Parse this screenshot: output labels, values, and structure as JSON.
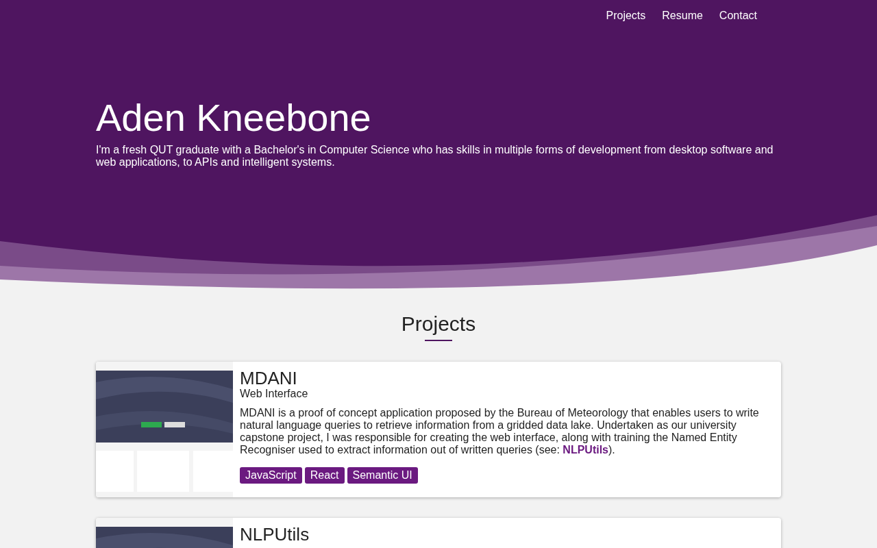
{
  "nav": [
    {
      "label": "Projects"
    },
    {
      "label": "Resume"
    },
    {
      "label": "Contact"
    }
  ],
  "hero": {
    "title": "Aden Kneebone",
    "intro": "I'm a fresh QUT graduate with a Bachelor's in Computer Science who has skills in multiple forms of development from desktop software and web applications, to APIs and intelligent systems."
  },
  "projects_heading": "Projects",
  "projects": [
    {
      "title": "MDANI",
      "subtitle": "Web Interface",
      "description": {
        "before": "MDANI is a proof of concept application proposed by the Bureau of Meteorology that enables users to write natural language queries to retrieve information from a gridded data lake. Undertaken as our university capstone project, I was responsible for creating the web interface, along with training the Named Entity Recogniser used to extract information out of written queries (see: ",
        "link": "NLPUtils",
        "after": ")."
      },
      "tags": [
        "JavaScript",
        "React",
        "Semantic UI"
      ]
    },
    {
      "title": "NLPUtils"
    }
  ]
}
